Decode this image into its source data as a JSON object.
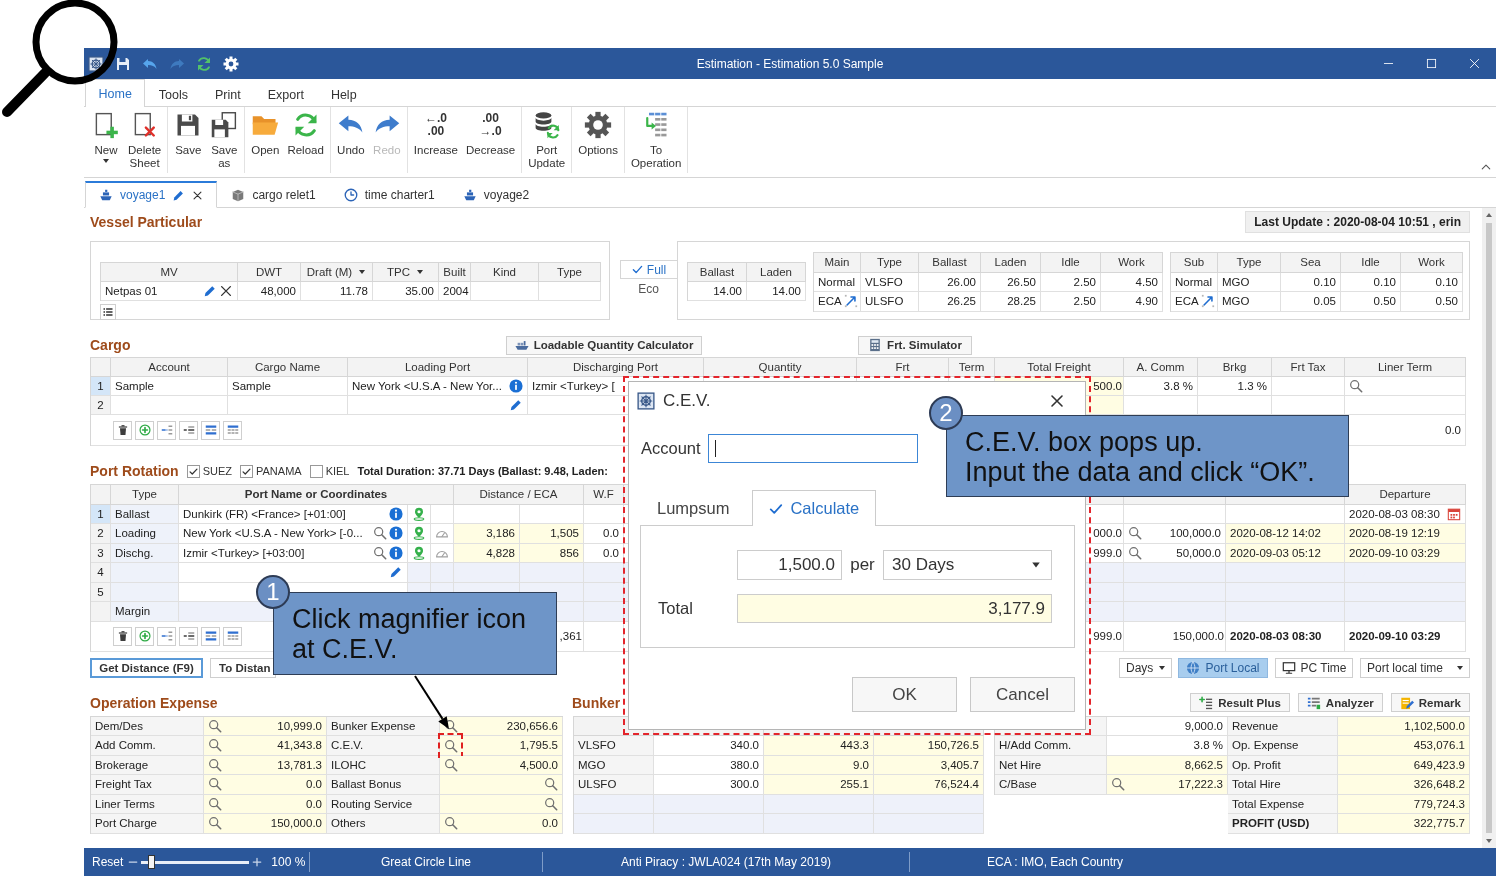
{
  "window": {
    "title": "Estimation - Estimation 5.0 Sample",
    "quick_access": [
      {
        "kind": "app",
        "disabled": false
      },
      {
        "kind": "save",
        "disabled": false
      },
      {
        "kind": "undo",
        "disabled": false
      },
      {
        "kind": "redo",
        "disabled": true
      },
      {
        "kind": "reload",
        "disabled": false
      },
      {
        "kind": "settings",
        "disabled": false
      }
    ]
  },
  "menu_tabs": [
    {
      "label": "Home",
      "selected": true
    },
    {
      "label": "Tools",
      "selected": false
    },
    {
      "label": "Print",
      "selected": false
    },
    {
      "label": "Export",
      "selected": false
    },
    {
      "label": "Help",
      "selected": false
    }
  ],
  "ribbon": [
    [
      {
        "kind": "new",
        "label": "New",
        "dropdown": true,
        "disabled": false
      },
      {
        "kind": "delete",
        "label": "Delete Sheet",
        "dropdown": false,
        "disabled": false
      }
    ],
    [
      {
        "kind": "save",
        "label": "Save",
        "dropdown": false,
        "disabled": false
      },
      {
        "kind": "saveas",
        "label": "Save as",
        "dropdown": false,
        "disabled": false
      }
    ],
    [
      {
        "kind": "open",
        "label": "Open",
        "dropdown": false,
        "disabled": false
      },
      {
        "kind": "reload",
        "label": "Reload",
        "dropdown": false,
        "disabled": false
      }
    ],
    [
      {
        "kind": "undo",
        "label": "Undo",
        "dropdown": false,
        "disabled": false
      },
      {
        "kind": "redo",
        "label": "Redo",
        "dropdown": false,
        "disabled": true
      }
    ],
    [
      {
        "kind": "decimal",
        "label": "Increase",
        "glyph": [
          "←.0",
          ".00"
        ],
        "dropdown": false,
        "disabled": false
      },
      {
        "kind": "decimal",
        "label": "Decrease",
        "glyph": [
          ".00",
          "→.0"
        ],
        "dropdown": false,
        "disabled": false
      }
    ],
    [
      {
        "kind": "port",
        "label": "Port Update",
        "dropdown": false,
        "disabled": false
      }
    ],
    [
      {
        "kind": "options",
        "label": "Options",
        "dropdown": false,
        "disabled": false
      }
    ],
    [
      {
        "kind": "operation",
        "label": "To Operation",
        "dropdown": false,
        "disabled": false
      }
    ]
  ],
  "doc_tabs": [
    {
      "kind": "voyage",
      "label": "voyage1",
      "selected": true
    },
    {
      "kind": "cargo",
      "label": "cargo relet1",
      "selected": false
    },
    {
      "kind": "timecharter",
      "label": "time charter1",
      "selected": false
    },
    {
      "kind": "voyage",
      "label": "voyage2",
      "selected": false
    }
  ],
  "vessel": {
    "title": "Vessel Particular",
    "last_update": "Last Update : 2020-08-04 10:51 , erin",
    "columns": [
      {
        "label": "MV",
        "dropdown": false
      },
      {
        "label": "DWT",
        "dropdown": false
      },
      {
        "label": "Draft (M)",
        "dropdown": true
      },
      {
        "label": "TPC",
        "dropdown": true
      },
      {
        "label": "Built",
        "dropdown": false
      },
      {
        "label": "Kind",
        "dropdown": false
      },
      {
        "label": "Type",
        "dropdown": false
      }
    ],
    "row": [
      {
        "text": "Netpas 01",
        "kind": "vessel"
      },
      {
        "text": "48,000"
      },
      {
        "text": "11.78"
      },
      {
        "text": "35.00"
      },
      {
        "text": "2004"
      }
    ]
  },
  "speed": {
    "modes": [
      {
        "label": "Full",
        "selected": true
      },
      {
        "label": "Eco",
        "selected": false
      }
    ],
    "columns": [
      "Ballast",
      "Laden"
    ],
    "values": [
      "14.00",
      "14.00"
    ]
  },
  "main_engine": {
    "columns": [
      "Main",
      "Type",
      "Ballast",
      "Laden",
      "Idle",
      "Work"
    ],
    "rows": [
      {
        "kind": "normal",
        "cells": [
          "Normal",
          "VLSFO",
          "26.00",
          "26.50",
          "2.50",
          "4.50"
        ]
      },
      {
        "kind": "eca",
        "cells": [
          "ECA",
          "ULSFO",
          "26.25",
          "28.25",
          "2.50",
          "4.90"
        ]
      }
    ]
  },
  "sub_engine": {
    "columns": [
      "Sub",
      "Type",
      "Sea",
      "Idle",
      "Work"
    ],
    "rows": [
      {
        "kind": "normal",
        "cells": [
          "Normal",
          "MGO",
          "0.10",
          "0.10",
          "0.10"
        ]
      },
      {
        "kind": "eca",
        "cells": [
          "ECA",
          "MGO",
          "0.05",
          "0.50",
          "0.50"
        ]
      }
    ]
  },
  "cargo": {
    "title": "Cargo",
    "tools": [
      {
        "kind": "loadable",
        "label": "Loadable Quantity Calculator"
      },
      {
        "kind": "simulator",
        "label": "Frt. Simulator"
      }
    ],
    "columns": [
      "Account",
      "Cargo Name",
      "Loading Port",
      "Discharging Port",
      "Quantity",
      "Frt",
      "Term",
      "Total Freight",
      "A. Comm",
      "Brkg",
      "Frt Tax",
      "Liner Term"
    ],
    "rows": [
      {
        "num": "1",
        "selected": true,
        "cells": [
          {
            "text": "Sample"
          },
          {
            "text": "Sample"
          },
          {
            "text": "New York <U.S.A - New Yor...",
            "kind": "info"
          },
          {
            "text": "Izmir <Turkey> ["
          },
          null,
          null,
          null,
          {
            "text": "500.0"
          },
          {
            "text": "3.8 %"
          },
          {
            "text": "1.3 %"
          },
          null,
          {
            "kind": "lookup"
          }
        ]
      },
      {
        "num": "2",
        "selected": false,
        "cells": [
          null,
          null,
          {
            "kind": "edit"
          },
          null,
          null,
          null,
          null,
          null,
          null,
          null,
          null,
          null
        ]
      }
    ],
    "row_tools": [
      {
        "kind": "delete"
      },
      {
        "kind": "add"
      },
      {
        "kind": "split"
      },
      {
        "kind": "insert"
      },
      {
        "kind": "rows"
      },
      {
        "kind": "grid"
      }
    ],
    "footer_value": "0.0"
  },
  "port_rotation": {
    "title": "Port Rotation",
    "canals": [
      {
        "label": "SUEZ",
        "checked": true
      },
      {
        "label": "PANAMA",
        "checked": true
      },
      {
        "label": "KIEL",
        "checked": false
      }
    ],
    "duration": "Total Duration: 37.71 Days (Ballast: 9.48, Laden:",
    "columns": [
      "Type",
      "Port Name or Coordinates",
      "",
      "",
      "Distance / ECA",
      "",
      "W.F",
      "",
      "",
      "",
      "",
      "",
      "",
      "Departure"
    ],
    "rows": [
      {
        "num": "1",
        "selected": true,
        "kind": "origin",
        "cells": [
          {
            "text": "Ballast"
          },
          {
            "text": "Dunkirk (FR) <France> [+01:00]",
            "kind": "info"
          },
          {
            "kind": "map"
          },
          null,
          null,
          null,
          null,
          null,
          null,
          null,
          null,
          null,
          null,
          {
            "text": "2020-08-03 08:30",
            "kind": "date"
          }
        ]
      },
      {
        "num": "2",
        "selected": false,
        "kind": "port",
        "cells": [
          {
            "text": "Loading"
          },
          {
            "text": "New York <U.S.A - New York> [-0...",
            "kind": "lookupinfo"
          },
          {
            "kind": "map"
          },
          {
            "kind": "speed"
          },
          {
            "text": "3,186"
          },
          {
            "text": "1,505"
          },
          {
            "text": "0.0"
          },
          null,
          null,
          null,
          {
            "text": "000.0"
          },
          {
            "kind": "lookup",
            "text": "100,000.0"
          },
          {
            "text": "2020-08-12 14:02"
          },
          {
            "text": "2020-08-19 12:19"
          }
        ]
      },
      {
        "num": "3",
        "selected": false,
        "kind": "port",
        "cells": [
          {
            "text": "Dischg."
          },
          {
            "text": "Izmir <Turkey> [+03:00]",
            "kind": "lookupinfo"
          },
          {
            "kind": "map"
          },
          {
            "kind": "speed"
          },
          {
            "text": "4,828"
          },
          {
            "text": "856"
          },
          {
            "text": "0.0"
          },
          null,
          null,
          null,
          {
            "text": "999.0"
          },
          {
            "kind": "lookup",
            "text": "50,000.0"
          },
          {
            "text": "2020-09-03 05:12"
          },
          {
            "text": "2020-09-10 03:29"
          }
        ]
      },
      {
        "num": "4",
        "selected": false,
        "kind": "blank",
        "cells": [
          null,
          {
            "kind": "edit"
          },
          null,
          null,
          null,
          null,
          null,
          null,
          null,
          null,
          null,
          null,
          null,
          null
        ]
      },
      {
        "num": "5",
        "selected": false,
        "kind": "blank",
        "cells": [
          null,
          null,
          null,
          null,
          null,
          null,
          null,
          null,
          null,
          null,
          null,
          null,
          null,
          null
        ]
      },
      {
        "selected": false,
        "kind": "margin",
        "cells": [
          {
            "text": "Margin"
          },
          null,
          null,
          null,
          null,
          null,
          null,
          null,
          null,
          null,
          null,
          null,
          null,
          null
        ]
      }
    ],
    "row_tools": [
      {
        "kind": "delete"
      },
      {
        "kind": "add"
      },
      {
        "kind": "split"
      },
      {
        "kind": "insert"
      },
      {
        "kind": "rows"
      },
      {
        "kind": "grid"
      }
    ],
    "footer": {
      "eca": {
        "text": ",361",
        "bold": false
      },
      "column_11": {
        "text": "999.0",
        "bold": false
      },
      "column_12": {
        "text": "150,000.0",
        "bold": false
      },
      "column_13": {
        "text": "2020-08-03 08:30",
        "bold": true
      },
      "departure": {
        "text": "2020-09-10 03:29",
        "bold": true
      }
    }
  },
  "distance_buttons": [
    {
      "label": "Get Distance (F9)",
      "focused": true
    },
    {
      "label": "To Distan",
      "focused": false
    }
  ],
  "time_controls": [
    {
      "kind": "dropdown",
      "label": "Days",
      "selected": false
    },
    {
      "kind": "local",
      "label": "Port Local",
      "selected": true
    },
    {
      "kind": "pc",
      "label": "PC Time",
      "selected": false
    },
    {
      "kind": "dropdown",
      "label": "Port local time",
      "selected": false
    }
  ],
  "operation_expense": {
    "title": "Operation Expense",
    "rows": [
      {
        "label": "Dem/Des",
        "value": "10,999.0",
        "label2": "Bunker Expense",
        "value2": "230,656.6",
        "marked": false
      },
      {
        "label": "Add Comm.",
        "value": "41,343.8",
        "label2": "C.E.V.",
        "value2": "1,795.5",
        "marked": true
      },
      {
        "label": "Brokerage",
        "value": "13,781.3",
        "label2": "ILOHC",
        "value2": "4,500.0",
        "marked": false
      },
      {
        "label": "Freight Tax",
        "value": "0.0",
        "label2": "Ballast Bonus",
        "marked": false
      },
      {
        "label": "Liner Terms",
        "value": "0.0",
        "label2": "Routing Service",
        "marked": false
      },
      {
        "label": "Port Charge",
        "value": "150,000.0",
        "label2": "Others",
        "value2": "0.0",
        "marked": false
      }
    ]
  },
  "bunker": {
    "title": "Bunker",
    "rows": [
      [
        "VLSFO",
        "340.0",
        "443.3",
        "150,726.5"
      ],
      [
        "MGO",
        "380.0",
        "9.0",
        "3,405.7"
      ],
      [
        "ULSFO",
        "300.0",
        "255.1",
        "76,524.4"
      ]
    ]
  },
  "hire": [
    {
      "kind": "plain",
      "value": "9,000.0"
    },
    {
      "kind": "plain",
      "label": "H/Add Comm.",
      "value": "3.8 %"
    },
    {
      "kind": "calc",
      "label": "Net Hire",
      "value": "8,662.5"
    },
    {
      "kind": "lookup",
      "label": "C/Base",
      "value": "17,222.3"
    }
  ],
  "results": [
    {
      "kind": "line",
      "label": "Revenue",
      "value": "1,102,500.0"
    },
    {
      "kind": "line",
      "label": "Op. Expense",
      "value": "453,076.1"
    },
    {
      "kind": "line",
      "label": "Op. Profit",
      "value": "649,423.9"
    },
    {
      "kind": "line",
      "label": "Total Hire",
      "value": "326,648.2"
    },
    {
      "kind": "line",
      "label": "Total Expense",
      "value": "779,724.3"
    },
    {
      "kind": "total",
      "label": "PROFIT (USD)",
      "value": "322,775.7"
    }
  ],
  "result_tools": [
    {
      "kind": "result_plus",
      "label": "Result Plus"
    },
    {
      "kind": "analyzer",
      "label": "Analyzer"
    },
    {
      "kind": "remark",
      "label": "Remark"
    }
  ],
  "status": {
    "reset": "Reset",
    "zoom": {
      "level": 0.07,
      "reading": "100 %"
    },
    "items": [
      "Great Circle Line",
      "Anti Piracy : JWLA024 (17th May 2019)",
      "ECA : IMO, Each Country"
    ]
  },
  "dialog": {
    "title": "C.E.V.",
    "account": {
      "label": "Account",
      "focused": true
    },
    "tabs": [
      {
        "label": "Lumpsum",
        "selected": false
      },
      {
        "label": "Calculate",
        "selected": true
      }
    ],
    "amount": "1,500.0",
    "per": "per",
    "period": "30 Days",
    "total_label": "Total",
    "total": "3,177.9",
    "buttons": [
      "OK",
      "Cancel"
    ]
  },
  "callouts": [
    {
      "number": "1",
      "text": "Click magnifier icon\nat C.E.V."
    },
    {
      "number": "2",
      "text": "C.E.V. box pops up.\nInput the data and click “OK”."
    }
  ]
}
